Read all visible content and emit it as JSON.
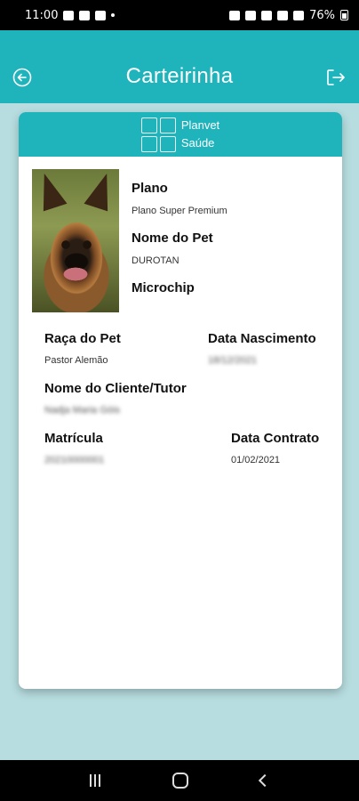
{
  "status_bar": {
    "time": "11:00",
    "battery": "76%"
  },
  "app_bar": {
    "title": "Carteirinha",
    "back_icon": "back-arrow-icon",
    "logout_icon": "logout-icon",
    "color": "#1fb3bb"
  },
  "card": {
    "logo": {
      "line1": "Planvet",
      "line2": "Saúde"
    },
    "plan_label": "Plano",
    "plan_value": "Plano Super Premium",
    "pet_name_label": "Nome do Pet",
    "pet_name_value": "DUROTAN",
    "microchip_label": "Microchip",
    "breed_label": "Raça do Pet",
    "breed_value": "Pastor Alemão",
    "birth_label": "Data Nascimento",
    "birth_value": "18/12/2021",
    "client_label": "Nome do Cliente/Tutor",
    "client_value": "Nadja Maria Góis",
    "registration_label": "Matrícula",
    "registration_value": "20210000001",
    "contract_label": "Data Contrato",
    "contract_value": "01/02/2021"
  }
}
